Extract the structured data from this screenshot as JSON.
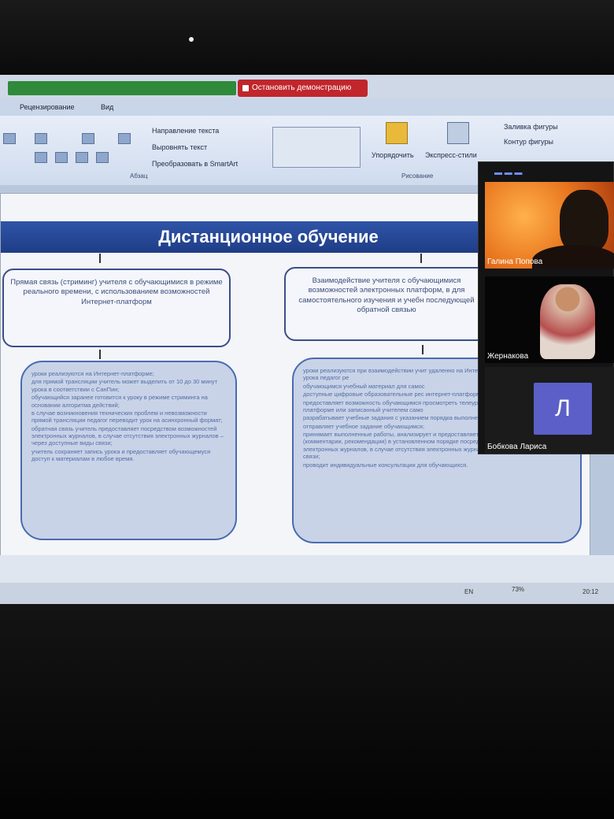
{
  "share_bar": {
    "stop_label": "Остановить демонстрацию"
  },
  "ribbon": {
    "tabs": [
      "Рецензирование",
      "Вид"
    ],
    "text_direction": "Направление текста",
    "align_text": "Выровнять текст",
    "convert_smartart": "Преобразовать в SmartArt",
    "arrange": "Упорядочить",
    "quick_styles": "Экспресс-стили",
    "shape_fill": "Заливка фигуры",
    "shape_outline": "Контур фигуры",
    "group_paragraph": "Абзац",
    "group_drawing": "Рисование"
  },
  "slide": {
    "title": "Дистанционное обучение",
    "left_box": "Прямая связь (стриминг) учителя с обучающимися в режиме реального времени, с использованием возможностей Интернет-платформ",
    "right_box": "Взаимодействие учителя с обучающимися возможностей электронных платформ, в для самостоятельного изучения и учебн последующей обратной связью",
    "left_list": [
      "уроки реализуются на Интернет-платформе;",
      "для прямой трансляции учитель может выделить от 10 до 30 минут урока в соответствии с СанПин;",
      "обучающийся заранее готовится к уроку в режиме стриминга на основании алгоритма действий;",
      "в случае возникновения технических проблем и невозможности прямой трансляции педагог переводит урок на асинхронный формат;",
      "обратная связь учитель предоставляет посредством возможностей электронных журналов, в случае отсутствия электронных журналов – через доступные виды связи;",
      "учитель сохраняет запись урока и предоставляет обучающемуся доступ к материалам в любое время."
    ],
    "right_list": [
      "уроки реализуются при взаимодействии учит удаленно на Интернет-платформе; при подготовке урока педагог ре",
      "обучающимся учебный материал для самос",
      "доступные цифровые образовательные рес интернет-платформе;",
      "предоставляет возможность обучающимся просмотреть телеурок или видеоурок, разм платформе или записанный учителем само",
      "разрабатывает учебные задания с указанием порядка выполнения и затрат времени;",
      "отправляет учебное задание обучающимся;",
      "принимает выполненные работы, анализирует и предоставляет обратную связь обучающимся (комментарии, рекомендации) в установленном порядке посредством возможностей электронных журналов, в случае отсутствия электронных журналов – через доступные виды связи;",
      "проводит индивидуальные консультации для обучающихся."
    ]
  },
  "taskbar": {
    "lang": "EN",
    "zoom": "73%",
    "clock": "20:12"
  },
  "participants": [
    {
      "name": "Галина Попова"
    },
    {
      "name": "Жернакова"
    },
    {
      "name": "Бобкова Лариса",
      "initial": "Л"
    }
  ],
  "colors": {
    "stop_red": "#c0262c",
    "title_blue": "#1f3d86",
    "avatar": "#5b5fc7"
  }
}
